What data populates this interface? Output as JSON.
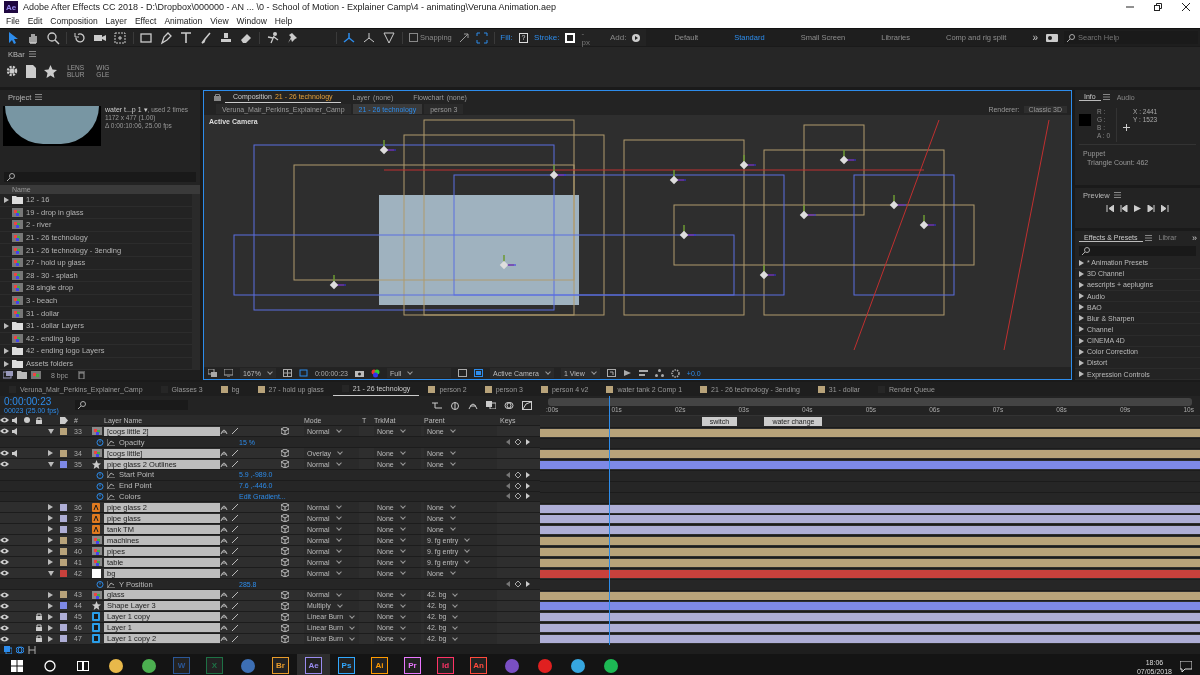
{
  "window": {
    "badge": "Ae",
    "title": "Adobe After Effects CC 2018 - D:\\Dropbox\\000000 - AN ... \\0 - School of Motion - Explainer Camp\\4 - animating\\Veruna Animation.aep"
  },
  "menu": [
    "File",
    "Edit",
    "Composition",
    "Layer",
    "Effect",
    "Animation",
    "View",
    "Window",
    "Help"
  ],
  "toolbar": {
    "snapping": {
      "label": "Snapping",
      "checked": false
    },
    "fill_label": "Fill:",
    "fill_value": "?",
    "stroke_label": "Stroke:",
    "stroke_width": "- px",
    "add_label": "Add:"
  },
  "workspaces": [
    {
      "label": "Default",
      "selected": false
    },
    {
      "label": "Standard",
      "selected": true
    },
    {
      "label": "Small Screen",
      "selected": false
    },
    {
      "label": "Libraries",
      "selected": false
    },
    {
      "label": "Comp and rig split",
      "selected": false
    }
  ],
  "workspace_more": "»",
  "search_help": {
    "placeholder": "Search Help"
  },
  "kbar": {
    "title": "KBar",
    "buttons": [
      {
        "kind": "gear"
      },
      {
        "kind": "page"
      },
      {
        "kind": "star"
      },
      {
        "kind": "text",
        "lines": [
          "LENS",
          "BLUR"
        ]
      },
      {
        "kind": "text",
        "lines": [
          "WIG",
          "GLE"
        ]
      }
    ]
  },
  "project": {
    "title": "Project",
    "preview": {
      "name": "water t...p 1 ▾",
      "used": ", used 2 times",
      "size": "1172 x 477 (1.00)",
      "duration": "Δ 0:00:10:06, 25.00 fps"
    },
    "column": "Name",
    "bpc": "8 bpc",
    "items": [
      {
        "kind": "folder",
        "name": "12 - 16"
      },
      {
        "kind": "comp",
        "name": "19 - drop in glass"
      },
      {
        "kind": "comp",
        "name": "2 - river"
      },
      {
        "kind": "comp",
        "name": "21 - 26 technology"
      },
      {
        "kind": "comp",
        "name": "21 - 26 technology - 3ending"
      },
      {
        "kind": "comp",
        "name": "27 - hold up glass"
      },
      {
        "kind": "comp",
        "name": "28 - 30 - splash"
      },
      {
        "kind": "comp",
        "name": "28 single drop"
      },
      {
        "kind": "comp",
        "name": "3 - beach"
      },
      {
        "kind": "comp",
        "name": "31 - dollar"
      },
      {
        "kind": "folder",
        "name": "31 - dollar Layers"
      },
      {
        "kind": "comp",
        "name": "42 - ending logo"
      },
      {
        "kind": "folder",
        "name": "42 - ending logo Layers"
      },
      {
        "kind": "folder",
        "name": "Assets folders"
      }
    ]
  },
  "composition": {
    "tabs": [
      {
        "label": "Composition",
        "name": "21 - 26 technology",
        "selected": true
      },
      {
        "label": "Layer",
        "name": "(none)",
        "selected": false
      },
      {
        "label": "Flowchart",
        "name": "(none)",
        "selected": false
      }
    ],
    "breadcrumbs": [
      {
        "label": "Veruna_Mair_Perkins_Explainer_Camp",
        "selected": false
      },
      {
        "label": "21 - 26 technology",
        "selected": true
      },
      {
        "label": "person 3",
        "selected": false
      }
    ],
    "renderer_label": "Renderer:",
    "renderer": "Classic 3D",
    "view_label": "Active Camera",
    "footer": {
      "zoom": "167%",
      "time": "0:00:00:23",
      "resolution": "Full",
      "camera": "Active Camera",
      "views": "1 View",
      "exposure": "+0.0"
    }
  },
  "info": {
    "tabs": [
      {
        "label": "Info",
        "selected": true
      },
      {
        "label": "Audio",
        "selected": false
      }
    ],
    "channels": [
      "R :",
      "G :",
      "B :",
      "A : 0"
    ],
    "x": "X : 2441",
    "y": "Y : 1523",
    "tool": "Puppet",
    "triangles": "Triangle Count: 462"
  },
  "preview": {
    "title": "Preview"
  },
  "effects": {
    "tabs": [
      {
        "label": "Effects & Presets",
        "selected": true
      },
      {
        "label": "Librar",
        "selected": false
      }
    ],
    "more": "»",
    "items": [
      "* Animation Presets",
      "3D Channel",
      "aescripts + aeplugins",
      "Audio",
      "BAO",
      "Blur & Sharpen",
      "Channel",
      "CINEMA 4D",
      "Color Correction",
      "Distort",
      "Expression Controls"
    ]
  },
  "timeline": {
    "tabs": [
      {
        "label": "Veruna_Mair_Perkins_Explainer_Camp",
        "selected": false,
        "color": "#262626"
      },
      {
        "label": "Glasses 3",
        "selected": false,
        "color": "#262626"
      },
      {
        "label": "bg",
        "selected": false,
        "color": "#b8a37a"
      },
      {
        "label": "27 - hold up glass",
        "selected": false,
        "color": "#b8a37a"
      },
      {
        "label": "21 - 26 technology",
        "selected": true,
        "color": "#262626"
      },
      {
        "label": "person 2",
        "selected": false,
        "color": "#b8a37a"
      },
      {
        "label": "person 3",
        "selected": false,
        "color": "#b8a37a"
      },
      {
        "label": "person 4 v2",
        "selected": false,
        "color": "#b8a37a"
      },
      {
        "label": "water tank 2 Comp 1",
        "selected": false,
        "color": "#b8a37a"
      },
      {
        "label": "21 - 26 technology - 3ending",
        "selected": false,
        "color": "#b8a37a"
      },
      {
        "label": "31 - dollar",
        "selected": false,
        "color": "#b8a37a"
      },
      {
        "label": "Render Queue",
        "selected": false,
        "color": "#262626"
      }
    ],
    "timecode": "0:00:00:23",
    "frame": "00023 (25.00 fps)",
    "columns": {
      "number": "#",
      "name": "Layer Name",
      "mode": "Mode",
      "t": "T",
      "trkmat": "TrkMat",
      "parent": "Parent",
      "keys": "Keys"
    },
    "ruler": [
      ":00s",
      "01s",
      "02s",
      "03s",
      "04s",
      "05s",
      "06s",
      "07s",
      "08s",
      "09s",
      "10s"
    ],
    "markers": [
      {
        "label": "switch",
        "level": 0.245
      },
      {
        "label": "water change",
        "level": 0.34
      }
    ],
    "playhead": {
      "level": 0.095
    },
    "rows": [
      {
        "kind": "comp",
        "number": "33",
        "name": "[cogs little 2]",
        "color": "#b8a37a",
        "visible": true,
        "audio": true,
        "locked": false,
        "expanded": true,
        "mode": "Normal",
        "trkmat": "None",
        "parent": "None"
      },
      {
        "kind": "property",
        "name": "Opacity",
        "value": "15 %"
      },
      {
        "kind": "comp",
        "number": "34",
        "name": "[cogs little]",
        "color": "#b8a37a",
        "visible": true,
        "audio": true,
        "locked": false,
        "expanded": false,
        "mode": "Overlay",
        "trkmat": "None",
        "parent": "None"
      },
      {
        "kind": "shape",
        "number": "35",
        "name": "pipe glass 2 Outlines",
        "color": "#7e89e6",
        "visible": true,
        "audio": false,
        "locked": false,
        "expanded": true,
        "mode": "Normal",
        "trkmat": "None",
        "parent": "None"
      },
      {
        "kind": "property",
        "name": "Start Point",
        "value": "5.9 ,-989.0"
      },
      {
        "kind": "property",
        "name": "End Point",
        "value": "7.6 ,-446.0"
      },
      {
        "kind": "property",
        "name": "Colors",
        "value": "Edit Gradient..."
      },
      {
        "kind": "ai",
        "number": "36",
        "name": "pipe glass 2",
        "color": "#aeaed6",
        "visible": false,
        "audio": false,
        "locked": false,
        "expanded": false,
        "mode": "Normal",
        "trkmat": "None",
        "parent": "None"
      },
      {
        "kind": "ai",
        "number": "37",
        "name": "pipe glass",
        "color": "#aeaed6",
        "visible": false,
        "audio": false,
        "locked": false,
        "expanded": false,
        "mode": "Normal",
        "trkmat": "None",
        "parent": "None"
      },
      {
        "kind": "ai",
        "number": "38",
        "name": "tank TM",
        "color": "#aeaed6",
        "visible": false,
        "audio": false,
        "locked": false,
        "expanded": false,
        "mode": "Normal",
        "trkmat": "None",
        "parent": "None"
      },
      {
        "kind": "comp",
        "number": "39",
        "name": "machines",
        "color": "#b8a37a",
        "visible": true,
        "audio": false,
        "locked": false,
        "expanded": false,
        "mode": "Normal",
        "trkmat": "None",
        "parent": "9. fg entry"
      },
      {
        "kind": "comp",
        "number": "40",
        "name": "pipes",
        "color": "#b8a37a",
        "visible": true,
        "audio": false,
        "locked": false,
        "expanded": false,
        "mode": "Normal",
        "trkmat": "None",
        "parent": "9. fg entry"
      },
      {
        "kind": "comp",
        "number": "41",
        "name": "table",
        "color": "#b8a37a",
        "visible": true,
        "audio": false,
        "locked": false,
        "expanded": false,
        "mode": "Normal",
        "trkmat": "None",
        "parent": "9. fg entry"
      },
      {
        "kind": "solid",
        "number": "42",
        "name": "bg",
        "color": "#c8413c",
        "visible": true,
        "audio": false,
        "locked": false,
        "expanded": true,
        "mode": "Normal",
        "trkmat": "None",
        "parent": "None"
      },
      {
        "kind": "property",
        "name": "Y Position",
        "value": "285.8"
      },
      {
        "kind": "comp",
        "number": "43",
        "name": "glass",
        "color": "#b8a37a",
        "visible": true,
        "audio": false,
        "locked": false,
        "expanded": false,
        "mode": "Normal",
        "trkmat": "None",
        "parent": "42. bg"
      },
      {
        "kind": "shape",
        "number": "44",
        "name": "Shape Layer 3",
        "color": "#7e89e6",
        "visible": true,
        "audio": false,
        "locked": false,
        "expanded": false,
        "mode": "Multiply",
        "trkmat": "None",
        "parent": "42. bg"
      },
      {
        "kind": "psd",
        "number": "45",
        "name": "Layer 1 copy",
        "color": "#aeaed6",
        "visible": true,
        "audio": false,
        "locked": true,
        "expanded": false,
        "mode": "Linear Burn",
        "trkmat": "None",
        "parent": "42. bg"
      },
      {
        "kind": "psd",
        "number": "46",
        "name": "Layer 1",
        "color": "#aeaed6",
        "visible": true,
        "audio": false,
        "locked": true,
        "expanded": false,
        "mode": "Linear Burn",
        "trkmat": "None",
        "parent": "42. bg"
      },
      {
        "kind": "psd",
        "number": "47",
        "name": "Layer 1 copy 2",
        "color": "#aeaed6",
        "visible": true,
        "audio": false,
        "locked": true,
        "expanded": false,
        "mode": "Linear Burn",
        "trkmat": "None",
        "parent": "42. bg"
      }
    ]
  },
  "taskbar": {
    "apps": [
      {
        "kind": "glyph",
        "color": "#e8b84a",
        "selected": false
      },
      {
        "kind": "glyph",
        "color": "#4caf50",
        "selected": false
      },
      {
        "kind": "letter",
        "label": "W",
        "color": "#2b5797",
        "selected": false
      },
      {
        "kind": "letter",
        "label": "X",
        "color": "#1e7145",
        "selected": false
      },
      {
        "kind": "glyph",
        "color": "#3d6fb4",
        "selected": false
      },
      {
        "kind": "letter",
        "label": "Br",
        "color": "#e89b2a",
        "selected": false
      },
      {
        "kind": "letter",
        "label": "Ae",
        "color": "#9a8cf0",
        "selected": true
      },
      {
        "kind": "letter",
        "label": "Ps",
        "color": "#31a8ff",
        "selected": false
      },
      {
        "kind": "letter",
        "label": "Ai",
        "color": "#ff9a00",
        "selected": false
      },
      {
        "kind": "letter",
        "label": "Pr",
        "color": "#ea77ff",
        "selected": false
      },
      {
        "kind": "letter",
        "label": "Id",
        "color": "#ff3366",
        "selected": false
      },
      {
        "kind": "letter",
        "label": "An",
        "color": "#ff4a3d",
        "selected": false
      },
      {
        "kind": "glyph",
        "color": "#7a4fc4",
        "selected": false
      },
      {
        "kind": "glyph",
        "color": "#e02020",
        "selected": false
      },
      {
        "kind": "glyph",
        "color": "#36a6df",
        "selected": false
      },
      {
        "kind": "glyph",
        "color": "#1db954",
        "selected": false
      }
    ],
    "time": "18:06",
    "date": "07/05/2018"
  }
}
